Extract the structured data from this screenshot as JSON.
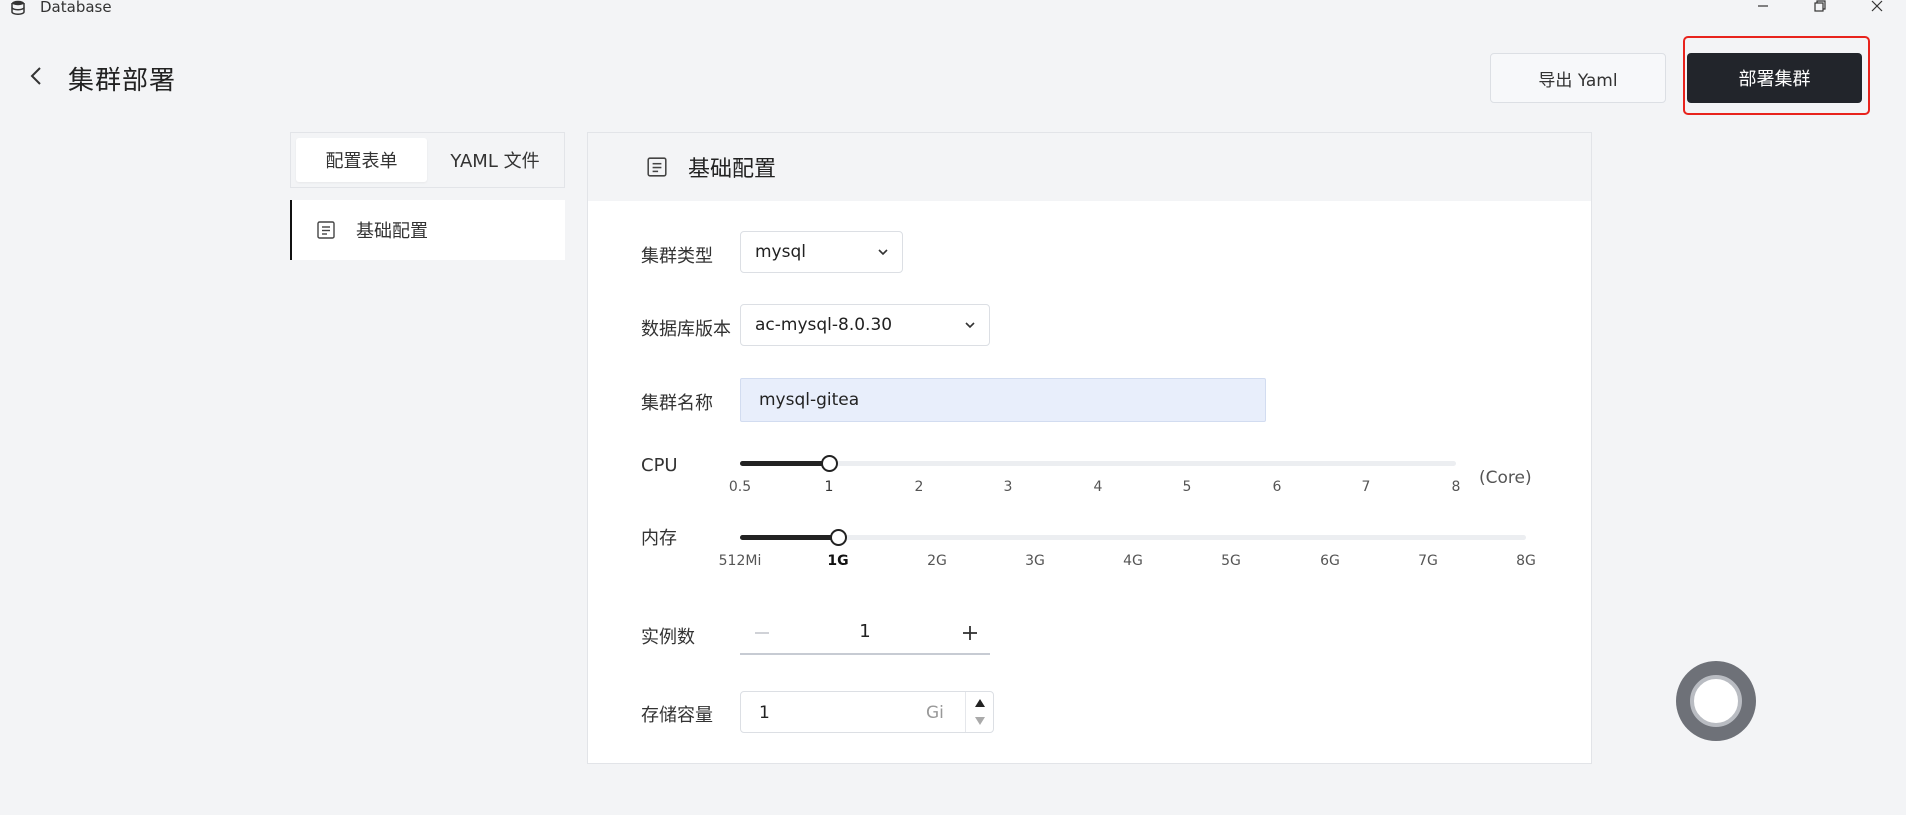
{
  "window": {
    "title": "Database",
    "app_icon": "database-icon",
    "controls": [
      "minimize-icon",
      "restore-icon",
      "close-icon"
    ]
  },
  "header": {
    "back_icon": "chevron-left-icon",
    "title": "集群部署",
    "export_label": "导出 Yaml",
    "deploy_label": "部署集群"
  },
  "left_panel": {
    "tabs": [
      {
        "label": "配置表单",
        "active": true
      },
      {
        "label": "YAML 文件",
        "active": false
      }
    ],
    "nav_items": [
      {
        "label": "基础配置",
        "icon": "document-icon",
        "active": true
      }
    ]
  },
  "section": {
    "title": "基础配置",
    "icon": "document-icon"
  },
  "form": {
    "cluster_type": {
      "label": "集群类型",
      "value": "mysql"
    },
    "db_version": {
      "label": "数据库版本",
      "value": "ac-mysql-8.0.30"
    },
    "cluster_name": {
      "label": "集群名称",
      "value": "mysql-gitea"
    },
    "cpu": {
      "label": "CPU",
      "ticks": [
        "0.5",
        "1",
        "2",
        "3",
        "4",
        "5",
        "6",
        "7",
        "8"
      ],
      "value": "1",
      "unit": "(Core)"
    },
    "memory": {
      "label": "内存",
      "ticks": [
        "512Mi",
        "1G",
        "2G",
        "3G",
        "4G",
        "5G",
        "6G",
        "7G",
        "8G"
      ],
      "value": "1G"
    },
    "replicas": {
      "label": "实例数",
      "value": "1"
    },
    "storage": {
      "label": "存储容量",
      "value": "1",
      "unit": "Gi"
    }
  },
  "colors": {
    "primary_dark": "#22252b",
    "highlight_red": "#e8231d",
    "input_fill": "#e8eefb",
    "background": "#f3f4f6"
  }
}
